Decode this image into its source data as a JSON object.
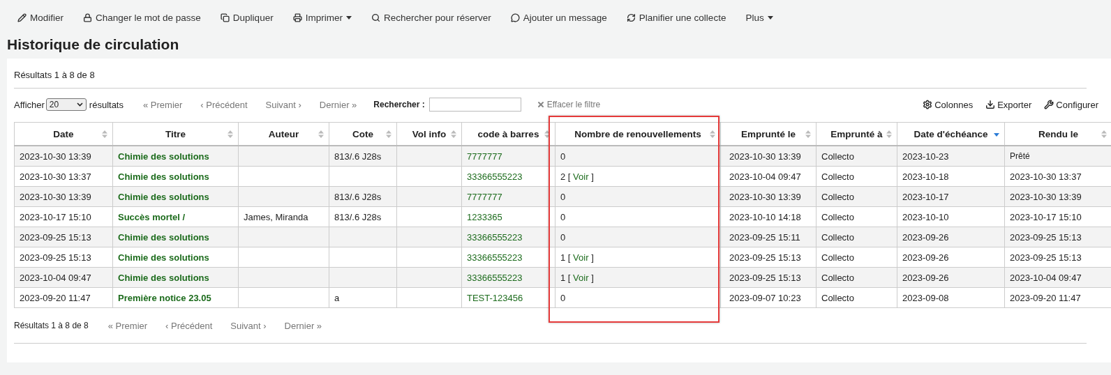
{
  "toolbar": [
    {
      "label": "Modifier",
      "dropdown": false
    },
    {
      "label": "Changer le mot de passe",
      "dropdown": false
    },
    {
      "label": "Dupliquer",
      "dropdown": false
    },
    {
      "label": "Imprimer",
      "dropdown": true
    },
    {
      "label": "Rechercher pour réserver",
      "dropdown": false
    },
    {
      "label": "Ajouter un message",
      "dropdown": false
    },
    {
      "label": "Planifier une collecte",
      "dropdown": false
    },
    {
      "label": "Plus",
      "dropdown": true
    }
  ],
  "title": "Historique de circulation",
  "results_top": "Résultats 1 à 8 de 8",
  "length": {
    "before": "Afficher",
    "value": "20",
    "after": "résultats"
  },
  "pager_top": [
    "« Premier",
    "‹ Précédent",
    "Suivant ›",
    "Dernier »"
  ],
  "search": {
    "label": "Rechercher :"
  },
  "clear_filter": "Effacer le filtre",
  "actions": [
    {
      "label": "Colonnes"
    },
    {
      "label": "Exporter"
    },
    {
      "label": "Configurer"
    }
  ],
  "table": {
    "columns": [
      {
        "label": "Date",
        "sorted": false,
        "highlighted": false
      },
      {
        "label": "Titre",
        "sorted": false,
        "highlighted": false
      },
      {
        "label": "Auteur",
        "sorted": false,
        "highlighted": false
      },
      {
        "label": "Cote",
        "sorted": false,
        "highlighted": false
      },
      {
        "label": "Vol info",
        "sorted": false,
        "highlighted": false
      },
      {
        "label": "code à barres",
        "sorted": false,
        "highlighted": false
      },
      {
        "label": "Nombre de renouvellements",
        "sorted": false,
        "highlighted": true
      },
      {
        "label": "Emprunté le",
        "sorted": false,
        "highlighted": false
      },
      {
        "label": "Emprunté à",
        "sorted": false,
        "highlighted": false
      },
      {
        "label": "Date d'échéance",
        "sorted": true,
        "highlighted": false
      },
      {
        "label": "Rendu le",
        "sorted": false,
        "highlighted": false
      }
    ],
    "rows": [
      {
        "date": "2023-10-30 13:39",
        "title": "Chimie des solutions",
        "author": "",
        "call": "813/.6 J28s",
        "vol": "",
        "barcode": "7777777",
        "renewals": {
          "count": "0"
        },
        "checkout": "2023-10-30 13:39",
        "library": "Collecto",
        "due": "2023-10-23",
        "returned": "Prêté"
      },
      {
        "date": "2023-10-30 13:37",
        "title": "Chimie des solutions",
        "author": "",
        "call": "",
        "vol": "",
        "barcode": "33366555223",
        "renewals": {
          "count": "2",
          "open": "[",
          "link": "Voir",
          "close": "]"
        },
        "checkout": "2023-10-04 09:47",
        "library": "Collecto",
        "due": "2023-10-18",
        "returned": "2023-10-30 13:37"
      },
      {
        "date": "2023-10-30 13:39",
        "title": "Chimie des solutions",
        "author": "",
        "call": "813/.6 J28s",
        "vol": "",
        "barcode": "7777777",
        "renewals": {
          "count": "0"
        },
        "checkout": "2023-10-30 13:39",
        "library": "Collecto",
        "due": "2023-10-17",
        "returned": "2023-10-30 13:39"
      },
      {
        "date": "2023-10-17 15:10",
        "title": "Succès mortel /",
        "author": "James, Miranda",
        "call": "813/.6 J28s",
        "vol": "",
        "barcode": "1233365",
        "renewals": {
          "count": "0"
        },
        "checkout": "2023-10-10 14:18",
        "library": "Collecto",
        "due": "2023-10-10",
        "returned": "2023-10-17 15:10"
      },
      {
        "date": "2023-09-25 15:13",
        "title": "Chimie des solutions",
        "author": "",
        "call": "",
        "vol": "",
        "barcode": "33366555223",
        "renewals": {
          "count": "0"
        },
        "checkout": "2023-09-25 15:11",
        "library": "Collecto",
        "due": "2023-09-26",
        "returned": "2023-09-25 15:13"
      },
      {
        "date": "2023-09-25 15:13",
        "title": "Chimie des solutions",
        "author": "",
        "call": "",
        "vol": "",
        "barcode": "33366555223",
        "renewals": {
          "count": "1",
          "open": "[",
          "link": "Voir",
          "close": "]"
        },
        "checkout": "2023-09-25 15:13",
        "library": "Collecto",
        "due": "2023-09-26",
        "returned": "2023-09-25 15:13"
      },
      {
        "date": "2023-10-04 09:47",
        "title": "Chimie des solutions",
        "author": "",
        "call": "",
        "vol": "",
        "barcode": "33366555223",
        "renewals": {
          "count": "1",
          "open": "[",
          "link": "Voir",
          "close": "]"
        },
        "checkout": "2023-09-25 15:13",
        "library": "Collecto",
        "due": "2023-09-26",
        "returned": "2023-10-04 09:47"
      },
      {
        "date": "2023-09-20 11:47",
        "title": "Première notice 23.05",
        "author": "",
        "call": "a",
        "vol": "",
        "barcode": "TEST-123456",
        "renewals": {
          "count": "0"
        },
        "checkout": "2023-09-07 10:23",
        "library": "Collecto",
        "due": "2023-09-08",
        "returned": "2023-09-20 11:47"
      }
    ]
  },
  "results_bottom": "Résultats 1 à 8 de 8",
  "pager_bottom": [
    "« Premier",
    "‹ Précédent",
    "Suivant ›",
    "Dernier »"
  ]
}
